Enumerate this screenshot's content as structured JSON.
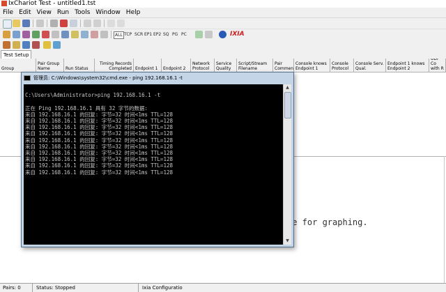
{
  "window": {
    "title": "IxChariot Test - untitled1.tst"
  },
  "menu": [
    "File",
    "Edit",
    "View",
    "Run",
    "Tools",
    "Window",
    "Help"
  ],
  "toolbar": {
    "protocol_filters": [
      "ALL",
      "TCP",
      "SCR",
      "EP1",
      "EP2",
      "SQ",
      "PG",
      "PC"
    ],
    "brand": "IXIA"
  },
  "tabs": [
    "Test Setup"
  ],
  "table": {
    "columns": [
      "Group",
      "Pair Group Name",
      "Run Status",
      "Timing Records Completed",
      "Endpoint 1",
      "Endpoint 2",
      "Network Protocol",
      "Service Quality",
      "Script/Stream Filename",
      "Pair Comment",
      "Console knows Endpoint 1",
      "Console Protocol",
      "Console Serv. Qual.",
      "Endpoint 1 knows Endpoint 2",
      "UDP Co with R"
    ]
  },
  "graph_message": "le for graphing.",
  "status": {
    "pairs": "Pairs: 0",
    "run_status": "Status: Stopped",
    "config": "Ixia Configuratio"
  },
  "cmd": {
    "title": "管理员: C:\\Windows\\system32\\cmd.exe - ping  192.168.16.1 -t",
    "lines": [
      "",
      "C:\\Users\\Administrator>ping 192.168.16.1 -t",
      "",
      "正在 Ping 192.168.16.1 具有 32 字节的数据:",
      "来自 192.168.16.1 的回复: 字节=32 时间<1ms TTL=128",
      "来自 192.168.16.1 的回复: 字节=32 时间<1ms TTL=128",
      "来自 192.168.16.1 的回复: 字节=32 时间<1ms TTL=128",
      "来自 192.168.16.1 的回复: 字节=32 时间<1ms TTL=128",
      "来自 192.168.16.1 的回复: 字节=32 时间<1ms TTL=128",
      "来自 192.168.16.1 的回复: 字节=32 时间<1ms TTL=128",
      "来自 192.168.16.1 的回复: 字节=32 时间<1ms TTL=128",
      "来自 192.168.16.1 的回复: 字节=32 时间<1ms TTL=128",
      "来自 192.168.16.1 的回复: 字节=32 时间<1ms TTL=128",
      "来自 192.168.16.1 的回复: 字节=32 时间<1ms TTL=128"
    ]
  },
  "colors": {
    "cmd_background": "#000000",
    "cmd_text": "#c8c8c8",
    "ixia_red": "#cc1f1f",
    "window_frame": "#c4d5e8"
  }
}
